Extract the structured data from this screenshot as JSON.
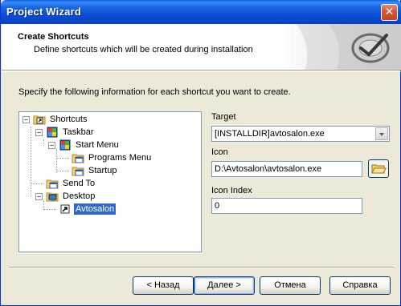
{
  "window": {
    "title": "Project Wizard",
    "close_glyph": "✕"
  },
  "header": {
    "title": "Create Shortcuts",
    "subtitle": "Define shortcuts which will be created during installation"
  },
  "instruction": "Specify the following information for each shortcut you want to create.",
  "tree": {
    "items": [
      {
        "label": "Shortcuts",
        "icon": "shortcut-folder-icon",
        "expanded": true
      },
      {
        "label": "Taskbar",
        "icon": "taskbar-icon",
        "expanded": true
      },
      {
        "label": "Start Menu",
        "icon": "start-menu-icon",
        "expanded": true
      },
      {
        "label": "Programs Menu",
        "icon": "programs-folder-icon"
      },
      {
        "label": "Startup",
        "icon": "startup-folder-icon"
      },
      {
        "label": "Send To",
        "icon": "send-to-folder-icon"
      },
      {
        "label": "Desktop",
        "icon": "desktop-icon",
        "expanded": true
      },
      {
        "label": "Avtosalon",
        "icon": "shortcut-icon",
        "selected": true
      }
    ]
  },
  "fields": {
    "target_label": "Target",
    "target_value": "[INSTALLDIR]avtosalon.exe",
    "icon_label": "Icon",
    "icon_value": "D:\\Avtosalon\\avtosalon.exe",
    "icon_index_label": "Icon Index",
    "icon_index_value": "0"
  },
  "buttons": {
    "back": "< Назад",
    "next": "Далее >",
    "cancel": "Отмена",
    "help": "Справка"
  },
  "colors": {
    "titlebar": "#0a4fd6",
    "selection": "#316ac5",
    "dialog_bg": "#ece9d8"
  }
}
